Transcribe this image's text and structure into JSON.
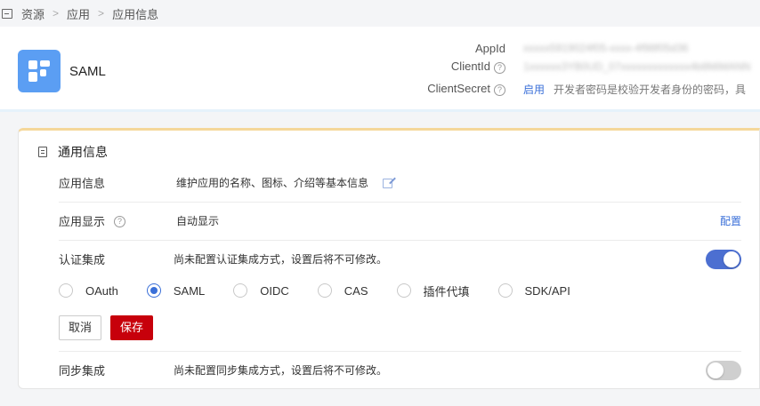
{
  "breadcrumb": {
    "items": [
      "资源",
      "应用",
      "应用信息"
    ],
    "separator": ">"
  },
  "app": {
    "name": "SAML",
    "appid_label": "AppId",
    "appid_value": "xxxxx5919024f05-xxxx-4f98f05d36",
    "clientid_label": "ClientId",
    "clientid_value": "1xxxxxx3YB0UD_07xxxxxxxxxxxxx4b8MiMANN",
    "clientsecret_label": "ClientSecret",
    "clientsecret_link": "启用",
    "clientsecret_desc": "开发者密码是校验开发者身份的密码，具"
  },
  "general": {
    "title": "通用信息",
    "app_info_label": "应用信息",
    "app_info_value": "维护应用的名称、图标、介绍等基本信息",
    "display_label": "应用显示",
    "display_value": "自动显示",
    "config_link": "配置",
    "auth_label": "认证集成",
    "auth_value": "尚未配置认证集成方式，设置后将不可修改。",
    "auth_enabled": true,
    "protocols": [
      "OAuth",
      "SAML",
      "OIDC",
      "CAS",
      "插件代填",
      "SDK/API"
    ],
    "selected_protocol": "SAML",
    "cancel_label": "取消",
    "save_label": "保存",
    "sync_label": "同步集成",
    "sync_value": "尚未配置同步集成方式，设置后将不可修改。",
    "sync_enabled": false
  },
  "colors": {
    "primary": "#3a6fd8",
    "save": "#c7000b",
    "toggle_on": "#4c6fd1",
    "logo": "#5b9ef3"
  }
}
